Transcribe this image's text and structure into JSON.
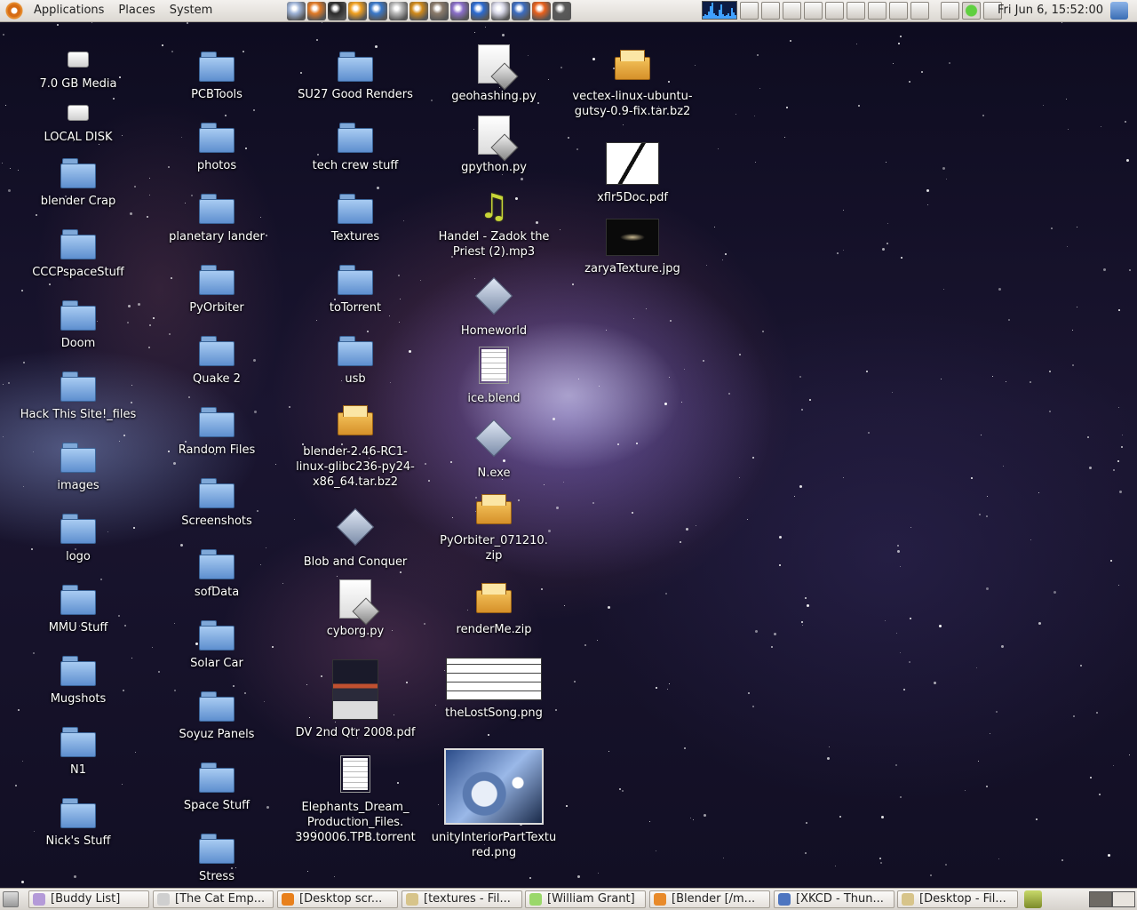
{
  "top_panel": {
    "menus": [
      "Applications",
      "Places",
      "System"
    ],
    "launchers": [
      {
        "name": "file-browser-icon",
        "color": "#9fb4d8"
      },
      {
        "name": "firefox-icon",
        "color": "#e07a26"
      },
      {
        "name": "terminal-icon",
        "color": "#2b2b2b"
      },
      {
        "name": "vlc-icon",
        "color": "#f0a020"
      },
      {
        "name": "system-monitor-icon",
        "color": "#3a78c8"
      },
      {
        "name": "settings-icon",
        "color": "#b9b9b9"
      },
      {
        "name": "money-icon",
        "color": "#d08a1a"
      },
      {
        "name": "gimp-icon",
        "color": "#8a7a6a"
      },
      {
        "name": "pidgin-icon",
        "color": "#8a6fc8"
      },
      {
        "name": "blender-icon",
        "color": "#2b6ad0"
      },
      {
        "name": "cards-icon",
        "color": "#d8d8e8"
      },
      {
        "name": "thunderbird-icon",
        "color": "#3c6cc0"
      },
      {
        "name": "firefox-browser-icon",
        "color": "#e8601c"
      },
      {
        "name": "calculator-icon",
        "color": "#5a5a5a"
      }
    ],
    "clock": "Fri Jun  6, 15:52:00"
  },
  "desktop_icons": [
    {
      "kind": "drive",
      "label": "7.0 GB Media"
    },
    {
      "kind": "drive",
      "label": "LOCAL DISK"
    },
    {
      "kind": "folder",
      "label": "blender Crap"
    },
    {
      "kind": "folder",
      "label": "CCCPspaceStuff"
    },
    {
      "kind": "folder",
      "label": "Doom"
    },
    {
      "kind": "folder",
      "label": "Hack This Site!_files"
    },
    {
      "kind": "folder",
      "label": "images"
    },
    {
      "kind": "folder",
      "label": "logo"
    },
    {
      "kind": "folder",
      "label": "MMU Stuff"
    },
    {
      "kind": "folder",
      "label": "Mugshots"
    },
    {
      "kind": "folder",
      "label": "N1"
    },
    {
      "kind": "folder",
      "label": "Nick's Stuff"
    },
    {
      "kind": "folder",
      "label": "PCBTools"
    },
    {
      "kind": "folder",
      "label": "photos"
    },
    {
      "kind": "folder",
      "label": "planetary lander"
    },
    {
      "kind": "folder",
      "label": "PyOrbiter"
    },
    {
      "kind": "folder",
      "label": "Quake 2"
    },
    {
      "kind": "folder",
      "label": "Random Files"
    },
    {
      "kind": "folder",
      "label": "Screenshots"
    },
    {
      "kind": "folder",
      "label": "sofData"
    },
    {
      "kind": "folder",
      "label": "Solar Car"
    },
    {
      "kind": "folder",
      "label": "Soyuz Panels"
    },
    {
      "kind": "folder",
      "label": "Space Stuff"
    },
    {
      "kind": "folder",
      "label": "Stress"
    },
    {
      "kind": "folder",
      "label": "SU27 Good Renders"
    },
    {
      "kind": "folder",
      "label": "tech crew stuff"
    },
    {
      "kind": "folder",
      "label": "Textures"
    },
    {
      "kind": "folder",
      "label": "toTorrent"
    },
    {
      "kind": "folder",
      "label": "usb"
    },
    {
      "kind": "pkg",
      "label": "blender-2.46-RC1-\nlinux-glibc236-py24-\nx86_64.tar.bz2"
    },
    {
      "kind": "diamond",
      "label": "Blob and Conquer"
    },
    {
      "kind": "script",
      "label": "cyborg.py"
    },
    {
      "kind": "dv-thumb",
      "label": "DV 2nd Qtr 2008.pdf"
    },
    {
      "kind": "textdoc",
      "label": "Elephants_Dream_\nProduction_Files.\n3990006.TPB.torrent"
    },
    {
      "kind": "script",
      "label": "geohashing.py"
    },
    {
      "kind": "script",
      "label": "gpython.py"
    },
    {
      "kind": "music",
      "label": "Handel - Zadok the\nPriest (2).mp3"
    },
    {
      "kind": "diamond",
      "label": "Homeworld"
    },
    {
      "kind": "textdoc",
      "label": "ice.blend"
    },
    {
      "kind": "diamond",
      "label": "N.exe"
    },
    {
      "kind": "pkg",
      "label": "PyOrbiter_071210.\nzip"
    },
    {
      "kind": "pkg",
      "label": "renderMe.zip"
    },
    {
      "kind": "song-thumb",
      "label": "theLostSong.png"
    },
    {
      "kind": "unity-thumb",
      "label": "unityInteriorPartTextu\nred.png"
    },
    {
      "kind": "pkg",
      "label": "vectex-linux-ubuntu-\ngutsy-0.9-fix.tar.bz2"
    },
    {
      "kind": "pdf-thumb",
      "label": "xflr5Doc.pdf"
    },
    {
      "kind": "zarya-thumb",
      "label": "zaryaTexture.jpg"
    }
  ],
  "taskbar": [
    {
      "label": "[Buddy List]",
      "color": "#b49ad8"
    },
    {
      "label": "[The Cat Emp...",
      "color": "#cfcfcf"
    },
    {
      "label": "[Desktop scr...",
      "color": "#e8801c"
    },
    {
      "label": "[textures - Fil...",
      "color": "#d7c48a"
    },
    {
      "label": "[William Grant]",
      "color": "#9ad86a"
    },
    {
      "label": "[Blender [/m...",
      "color": "#e88a2a"
    },
    {
      "label": "[XKCD - Thun...",
      "color": "#4d75c0"
    },
    {
      "label": "[Desktop - Fil...",
      "color": "#d7c48a"
    }
  ]
}
